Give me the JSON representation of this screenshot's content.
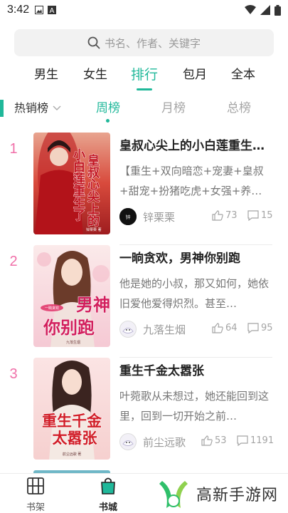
{
  "status_bar": {
    "time": "3:42"
  },
  "search": {
    "placeholder": "书名、作者、关键字"
  },
  "category_tabs": [
    "男生",
    "女生",
    "排行",
    "包月",
    "全本"
  ],
  "rank": {
    "type_label": "热销榜",
    "tabs": [
      "周榜",
      "月榜",
      "总榜"
    ]
  },
  "books": [
    {
      "rank": "1",
      "title": "皇叔心尖上的小白莲重生…",
      "desc": "【重生+双向暗恋+宠妻+皇叔+甜宠+扮猪吃虎+女强+养…",
      "author": "锌栗栗",
      "likes": "73",
      "comments": "15",
      "cover_text": "重生了小白莲 皇叔心尖上的",
      "cover_author": "锌栗栗 著"
    },
    {
      "rank": "2",
      "title": "一晌贪欢，男神你别跑",
      "desc": "他是她的小叔，那又如何，她依旧爱他爱得炽烈。甚至…",
      "author": "九落生烟",
      "likes": "64",
      "comments": "95",
      "cover_text": "男神你别跑",
      "cover_author": "九落生烟"
    },
    {
      "rank": "3",
      "title": "重生千金太嚣张",
      "desc": "叶菀歌从未想过，她还能回到这里，回到一切开始之前…",
      "author": "前尘远歌",
      "likes": "53",
      "comments": "1191",
      "cover_text": "重生千金太嚣张",
      "cover_author": "前尘远歌 著"
    }
  ],
  "bottom_nav": {
    "bookshelf": "书架",
    "bookstore": "书城"
  },
  "watermark": {
    "text": "高新手游网"
  },
  "colors": {
    "accent": "#20b89a",
    "rank_number": "#f06fa8"
  }
}
